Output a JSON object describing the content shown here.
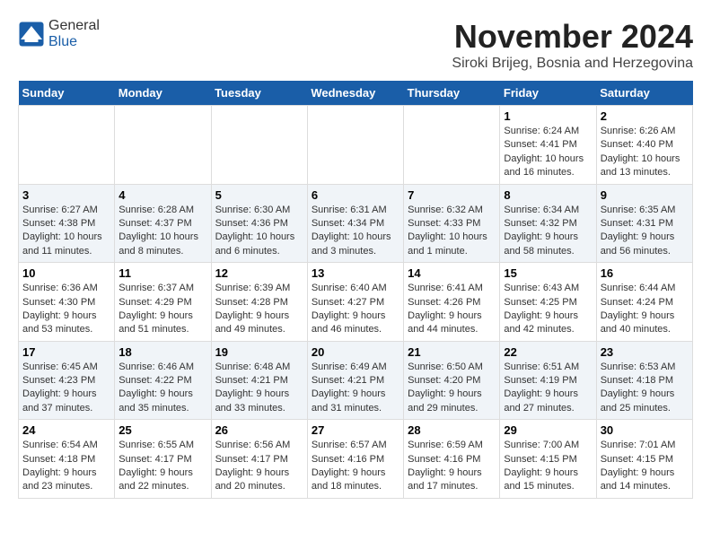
{
  "header": {
    "logo_general": "General",
    "logo_blue": "Blue",
    "month": "November 2024",
    "location": "Siroki Brijeg, Bosnia and Herzegovina"
  },
  "weekdays": [
    "Sunday",
    "Monday",
    "Tuesday",
    "Wednesday",
    "Thursday",
    "Friday",
    "Saturday"
  ],
  "weeks": [
    [
      {
        "day": "",
        "content": ""
      },
      {
        "day": "",
        "content": ""
      },
      {
        "day": "",
        "content": ""
      },
      {
        "day": "",
        "content": ""
      },
      {
        "day": "",
        "content": ""
      },
      {
        "day": "1",
        "content": "Sunrise: 6:24 AM\nSunset: 4:41 PM\nDaylight: 10 hours and 16 minutes."
      },
      {
        "day": "2",
        "content": "Sunrise: 6:26 AM\nSunset: 4:40 PM\nDaylight: 10 hours and 13 minutes."
      }
    ],
    [
      {
        "day": "3",
        "content": "Sunrise: 6:27 AM\nSunset: 4:38 PM\nDaylight: 10 hours and 11 minutes."
      },
      {
        "day": "4",
        "content": "Sunrise: 6:28 AM\nSunset: 4:37 PM\nDaylight: 10 hours and 8 minutes."
      },
      {
        "day": "5",
        "content": "Sunrise: 6:30 AM\nSunset: 4:36 PM\nDaylight: 10 hours and 6 minutes."
      },
      {
        "day": "6",
        "content": "Sunrise: 6:31 AM\nSunset: 4:34 PM\nDaylight: 10 hours and 3 minutes."
      },
      {
        "day": "7",
        "content": "Sunrise: 6:32 AM\nSunset: 4:33 PM\nDaylight: 10 hours and 1 minute."
      },
      {
        "day": "8",
        "content": "Sunrise: 6:34 AM\nSunset: 4:32 PM\nDaylight: 9 hours and 58 minutes."
      },
      {
        "day": "9",
        "content": "Sunrise: 6:35 AM\nSunset: 4:31 PM\nDaylight: 9 hours and 56 minutes."
      }
    ],
    [
      {
        "day": "10",
        "content": "Sunrise: 6:36 AM\nSunset: 4:30 PM\nDaylight: 9 hours and 53 minutes."
      },
      {
        "day": "11",
        "content": "Sunrise: 6:37 AM\nSunset: 4:29 PM\nDaylight: 9 hours and 51 minutes."
      },
      {
        "day": "12",
        "content": "Sunrise: 6:39 AM\nSunset: 4:28 PM\nDaylight: 9 hours and 49 minutes."
      },
      {
        "day": "13",
        "content": "Sunrise: 6:40 AM\nSunset: 4:27 PM\nDaylight: 9 hours and 46 minutes."
      },
      {
        "day": "14",
        "content": "Sunrise: 6:41 AM\nSunset: 4:26 PM\nDaylight: 9 hours and 44 minutes."
      },
      {
        "day": "15",
        "content": "Sunrise: 6:43 AM\nSunset: 4:25 PM\nDaylight: 9 hours and 42 minutes."
      },
      {
        "day": "16",
        "content": "Sunrise: 6:44 AM\nSunset: 4:24 PM\nDaylight: 9 hours and 40 minutes."
      }
    ],
    [
      {
        "day": "17",
        "content": "Sunrise: 6:45 AM\nSunset: 4:23 PM\nDaylight: 9 hours and 37 minutes."
      },
      {
        "day": "18",
        "content": "Sunrise: 6:46 AM\nSunset: 4:22 PM\nDaylight: 9 hours and 35 minutes."
      },
      {
        "day": "19",
        "content": "Sunrise: 6:48 AM\nSunset: 4:21 PM\nDaylight: 9 hours and 33 minutes."
      },
      {
        "day": "20",
        "content": "Sunrise: 6:49 AM\nSunset: 4:21 PM\nDaylight: 9 hours and 31 minutes."
      },
      {
        "day": "21",
        "content": "Sunrise: 6:50 AM\nSunset: 4:20 PM\nDaylight: 9 hours and 29 minutes."
      },
      {
        "day": "22",
        "content": "Sunrise: 6:51 AM\nSunset: 4:19 PM\nDaylight: 9 hours and 27 minutes."
      },
      {
        "day": "23",
        "content": "Sunrise: 6:53 AM\nSunset: 4:18 PM\nDaylight: 9 hours and 25 minutes."
      }
    ],
    [
      {
        "day": "24",
        "content": "Sunrise: 6:54 AM\nSunset: 4:18 PM\nDaylight: 9 hours and 23 minutes."
      },
      {
        "day": "25",
        "content": "Sunrise: 6:55 AM\nSunset: 4:17 PM\nDaylight: 9 hours and 22 minutes."
      },
      {
        "day": "26",
        "content": "Sunrise: 6:56 AM\nSunset: 4:17 PM\nDaylight: 9 hours and 20 minutes."
      },
      {
        "day": "27",
        "content": "Sunrise: 6:57 AM\nSunset: 4:16 PM\nDaylight: 9 hours and 18 minutes."
      },
      {
        "day": "28",
        "content": "Sunrise: 6:59 AM\nSunset: 4:16 PM\nDaylight: 9 hours and 17 minutes."
      },
      {
        "day": "29",
        "content": "Sunrise: 7:00 AM\nSunset: 4:15 PM\nDaylight: 9 hours and 15 minutes."
      },
      {
        "day": "30",
        "content": "Sunrise: 7:01 AM\nSunset: 4:15 PM\nDaylight: 9 hours and 14 minutes."
      }
    ]
  ]
}
